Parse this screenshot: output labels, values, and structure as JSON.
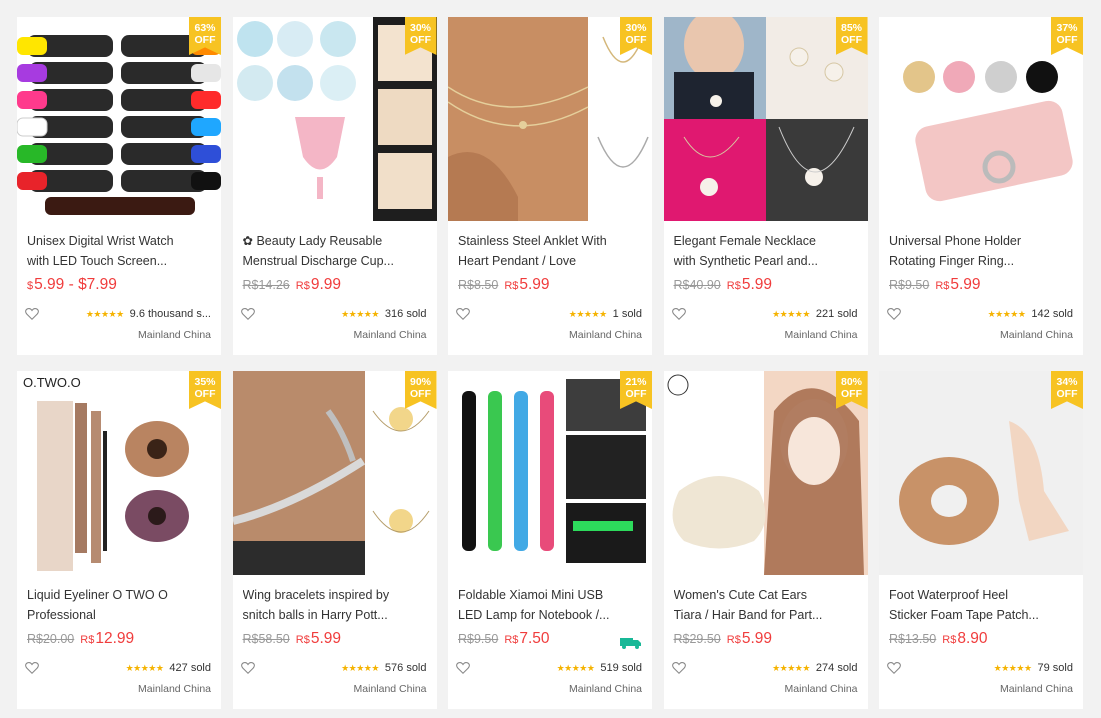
{
  "colors": {
    "accent": "#f03c3c",
    "badge": "#f7c322",
    "stars": "#f5b301"
  },
  "products": [
    {
      "discount": "63%",
      "off": "OFF",
      "title_l1": "Unisex Digital Wrist Watch",
      "title_l2": "with LED Touch Screen...",
      "old": "",
      "cur": "$",
      "price": "5.99 - $7.99",
      "stars": "★★★★★",
      "sold": "9.6 thousand s...",
      "ship": "Mainland China"
    },
    {
      "discount": "30%",
      "off": "OFF",
      "title_l1": "✿ Beauty Lady Reusable",
      "title_l2": "Menstrual Discharge Cup...",
      "old": "R$14.26",
      "cur": "R$",
      "price": "9.99",
      "stars": "★★★★★",
      "sold": "316 sold",
      "ship": "Mainland China"
    },
    {
      "discount": "30%",
      "off": "OFF",
      "title_l1": "Stainless Steel Anklet With",
      "title_l2": "Heart Pendant / Love",
      "old": "R$8.50",
      "cur": "R$",
      "price": "5.99",
      "stars": "★★★★★",
      "sold": "1 sold",
      "ship": "Mainland China"
    },
    {
      "discount": "85%",
      "off": "OFF",
      "title_l1": "Elegant Female Necklace",
      "title_l2": "with Synthetic Pearl and...",
      "old": "R$40.90",
      "cur": "R$",
      "price": "5.99",
      "stars": "★★★★★",
      "sold": "221 sold",
      "ship": "Mainland China"
    },
    {
      "discount": "37%",
      "off": "OFF",
      "title_l1": "Universal Phone Holder",
      "title_l2": "Rotating Finger Ring...",
      "old": "R$9.50",
      "cur": "R$",
      "price": "5.99",
      "stars": "★★★★★",
      "sold": "142 sold",
      "ship": "Mainland China"
    },
    {
      "discount": "35%",
      "off": "OFF",
      "title_l1": "Liquid Eyeliner O TWO O",
      "title_l2": "Professional",
      "old": "R$20.00",
      "cur": "R$",
      "price": "12.99",
      "stars": "★★★★★",
      "sold": "427 sold",
      "ship": "Mainland China",
      "brand": "O.TWO.O"
    },
    {
      "discount": "90%",
      "off": "OFF",
      "title_l1": "Wing bracelets inspired by",
      "title_l2": "snitch balls in Harry Pott...",
      "old": "R$58.50",
      "cur": "R$",
      "price": "5.99",
      "stars": "★★★★★",
      "sold": "576 sold",
      "ship": "Mainland China"
    },
    {
      "discount": "21%",
      "off": "OFF",
      "title_l1": "Foldable Xiamoi Mini USB",
      "title_l2": "LED Lamp for Notebook /...",
      "old": "R$9.50",
      "cur": "R$",
      "price": "7.50",
      "stars": "★★★★★",
      "sold": "519 sold",
      "ship": "Mainland China",
      "truck": true
    },
    {
      "discount": "80%",
      "off": "OFF",
      "title_l1": "Women's Cute Cat Ears",
      "title_l2": "Tiara / Hair Band for Part...",
      "old": "R$29.50",
      "cur": "R$",
      "price": "5.99",
      "stars": "★★★★★",
      "sold": "274 sold",
      "ship": "Mainland China"
    },
    {
      "discount": "34%",
      "off": "OFF",
      "title_l1": "Foot Waterproof Heel",
      "title_l2": "Sticker Foam Tape Patch...",
      "old": "R$13.50",
      "cur": "R$",
      "price": "8.90",
      "stars": "★★★★★",
      "sold": "79 sold",
      "ship": "Mainland China"
    }
  ]
}
